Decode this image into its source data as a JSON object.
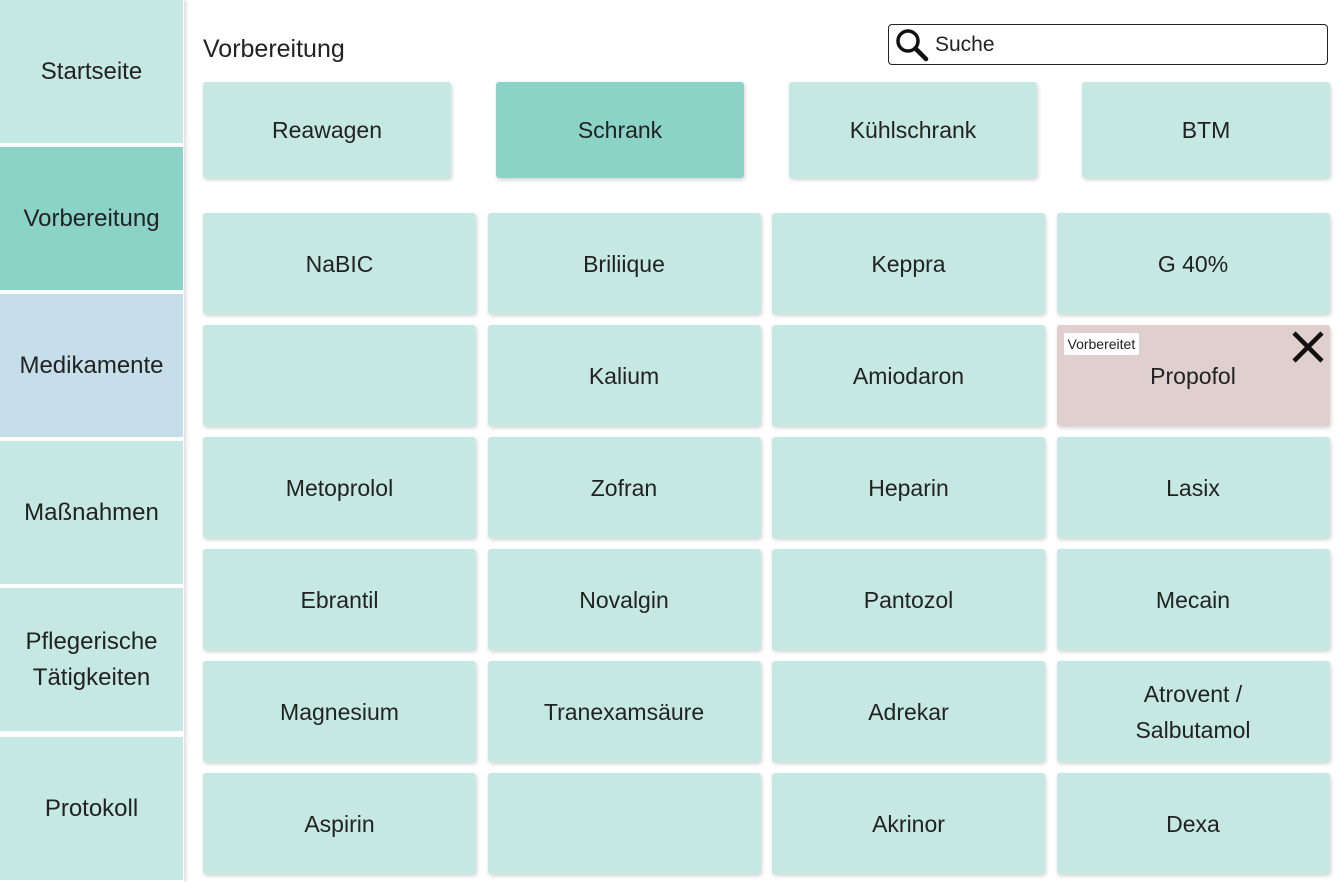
{
  "sidebar": {
    "items": [
      {
        "label": "Startseite"
      },
      {
        "label": "Vorbereitung",
        "active": true
      },
      {
        "label": "Medikamente"
      },
      {
        "label": "Maßnahmen"
      },
      {
        "label": "Pflegerische\nTätigkeiten"
      },
      {
        "label": "Protokoll"
      }
    ]
  },
  "header": {
    "title": "Vorbereitung"
  },
  "search": {
    "placeholder": "Suche",
    "value": ""
  },
  "categories": [
    {
      "label": "Reawagen"
    },
    {
      "label": "Schrank",
      "active": true
    },
    {
      "label": "Kühlschrank"
    },
    {
      "label": "BTM"
    }
  ],
  "medications": [
    {
      "label": "NaBIC"
    },
    {
      "label": "Briliique"
    },
    {
      "label": "Keppra"
    },
    {
      "label": "G 40%"
    },
    {
      "label": ""
    },
    {
      "label": "Kalium"
    },
    {
      "label": "Amiodaron"
    },
    {
      "label": "Propofol",
      "badge": "Vorbereitet",
      "prepared": true
    },
    {
      "label": "Metoprolol"
    },
    {
      "label": "Zofran"
    },
    {
      "label": "Heparin"
    },
    {
      "label": "Lasix"
    },
    {
      "label": "Ebrantil"
    },
    {
      "label": "Novalgin"
    },
    {
      "label": "Pantozol"
    },
    {
      "label": "Mecain"
    },
    {
      "label": "Magnesium"
    },
    {
      "label": "Tranexamsäure"
    },
    {
      "label": "Adrekar"
    },
    {
      "label": "Atrovent /\nSalbutamol"
    },
    {
      "label": "Aspirin"
    },
    {
      "label": ""
    },
    {
      "label": "Akrinor"
    },
    {
      "label": "Dexa"
    }
  ],
  "colors": {
    "tile": "#c5e8e2",
    "active": "#8bd3c7",
    "medikamente_nav": "#c6deea",
    "prepared_tile": "#e0cfcf"
  },
  "icons": {
    "search": "search-icon",
    "close": "close-icon"
  }
}
